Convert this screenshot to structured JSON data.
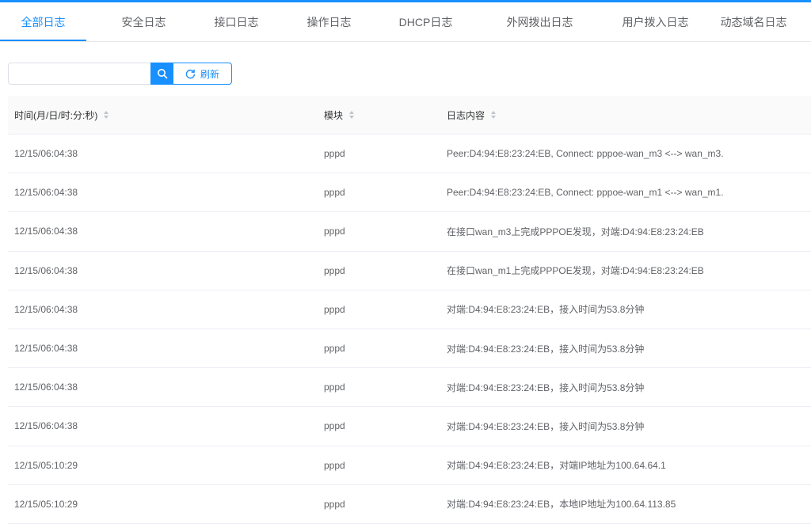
{
  "tabs": [
    {
      "label": "全部日志",
      "active": true
    },
    {
      "label": "安全日志",
      "active": false
    },
    {
      "label": "接口日志",
      "active": false
    },
    {
      "label": "操作日志",
      "active": false
    },
    {
      "label": "DHCP日志",
      "active": false
    },
    {
      "label": "外网拨出日志",
      "active": false
    },
    {
      "label": "用户拨入日志",
      "active": false
    },
    {
      "label": "动态域名日志",
      "active": false
    }
  ],
  "toolbar": {
    "search_value": "",
    "search_placeholder": "",
    "search_icon": "search-icon",
    "refresh_icon": "refresh-icon",
    "refresh_label": "刷新"
  },
  "table": {
    "columns": [
      {
        "label": "时间(月/日/时:分:秒)",
        "sortable": true
      },
      {
        "label": "模块",
        "sortable": true
      },
      {
        "label": "日志内容",
        "sortable": true
      }
    ],
    "rows": [
      {
        "time": "12/15/06:04:38",
        "module": "pppd",
        "content": "Peer:D4:94:E8:23:24:EB, Connect: pppoe-wan_m3 <--> wan_m3."
      },
      {
        "time": "12/15/06:04:38",
        "module": "pppd",
        "content": "Peer:D4:94:E8:23:24:EB, Connect: pppoe-wan_m1 <--> wan_m1."
      },
      {
        "time": "12/15/06:04:38",
        "module": "pppd",
        "content": "在接口wan_m3上完成PPPOE发现，对端:D4:94:E8:23:24:EB"
      },
      {
        "time": "12/15/06:04:38",
        "module": "pppd",
        "content": "在接口wan_m1上完成PPPOE发现，对端:D4:94:E8:23:24:EB"
      },
      {
        "time": "12/15/06:04:38",
        "module": "pppd",
        "content": "对端:D4:94:E8:23:24:EB，接入时间为53.8分钟"
      },
      {
        "time": "12/15/06:04:38",
        "module": "pppd",
        "content": "对端:D4:94:E8:23:24:EB，接入时间为53.8分钟"
      },
      {
        "time": "12/15/06:04:38",
        "module": "pppd",
        "content": "对端:D4:94:E8:23:24:EB，接入时间为53.8分钟"
      },
      {
        "time": "12/15/06:04:38",
        "module": "pppd",
        "content": "对端:D4:94:E8:23:24:EB，接入时间为53.8分钟"
      },
      {
        "time": "12/15/05:10:29",
        "module": "pppd",
        "content": "对端:D4:94:E8:23:24:EB，对端IP地址为100.64.64.1"
      },
      {
        "time": "12/15/05:10:29",
        "module": "pppd",
        "content": "对端:D4:94:E8:23:24:EB，本地IP地址为100.64.113.85"
      }
    ]
  },
  "colors": {
    "accent": "#1890ff",
    "text": "#606266",
    "header_text": "#303133",
    "border": "#ebeef5"
  }
}
